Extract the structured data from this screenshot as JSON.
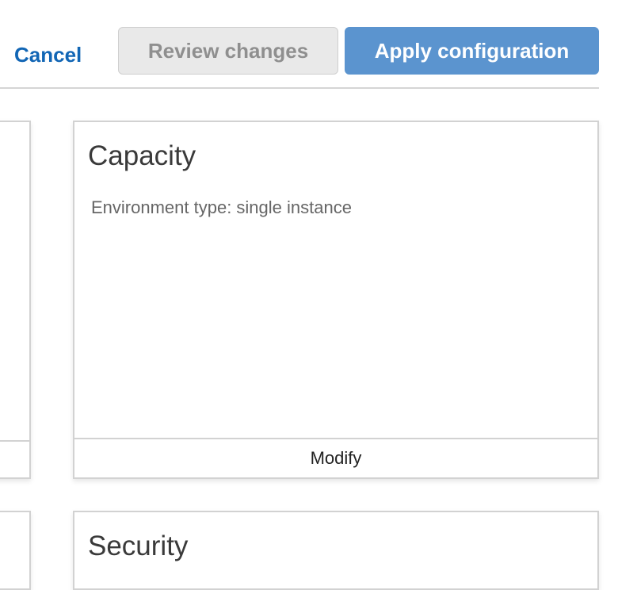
{
  "toolbar": {
    "cancel_label": "Cancel",
    "review_label": "Review changes",
    "apply_label": "Apply configuration"
  },
  "cards": {
    "capacity": {
      "title": "Capacity",
      "description": "Environment type: single instance",
      "action_label": "Modify"
    },
    "security": {
      "title": "Security"
    }
  },
  "colors": {
    "link": "#1266b5",
    "primary_button": "#5b94cf",
    "disabled_button": "#e9e9e9",
    "border": "#d2d2d2"
  }
}
